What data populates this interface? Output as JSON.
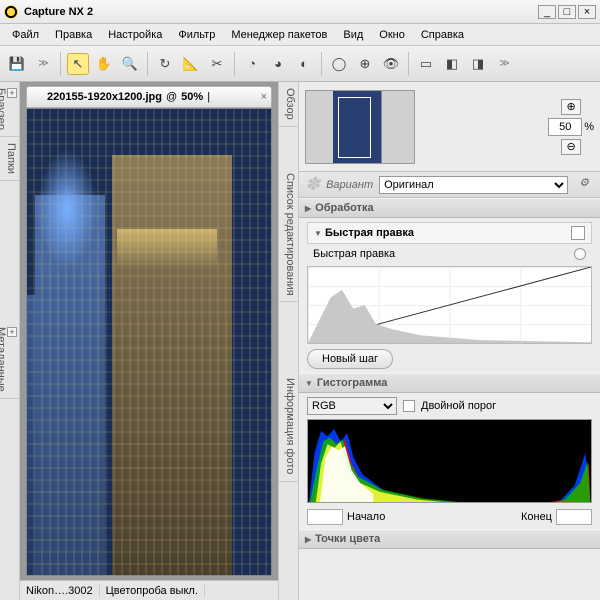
{
  "app": {
    "title": "Capture NX 2"
  },
  "menu": [
    "Файл",
    "Правка",
    "Настройка",
    "Фильтр",
    "Менеджер пакетов",
    "Вид",
    "Окно",
    "Справка"
  ],
  "image_tab": {
    "filename": "220155-1920x1200.jpg",
    "at": "@",
    "zoom": "50%",
    "pipe": "|"
  },
  "zoom": {
    "value": "50",
    "pct": "%"
  },
  "variant": {
    "label": "Вариант",
    "selected": "Оригинал"
  },
  "sections": {
    "processing": "Обработка",
    "quickedit_hdr": "Быстрая правка",
    "quickedit_sub": "Быстрая правка",
    "newstep": "Новый шаг",
    "histogram": "Гистограмма",
    "channel": "RGB",
    "dualthresh": "Двойной порог",
    "start": "Начало",
    "end": "Конец",
    "colorpoints": "Точки цвета"
  },
  "status": {
    "camera": "Nikon….3002",
    "colorproof": "Цветопроба выкл."
  },
  "side_left": {
    "browser": "Браузер",
    "folders": "Папки",
    "metadata": "Метаданные"
  },
  "side_right": {
    "overview": "Обзор",
    "editlist": "Список редактирования",
    "photoinfo": "Информация фото"
  }
}
